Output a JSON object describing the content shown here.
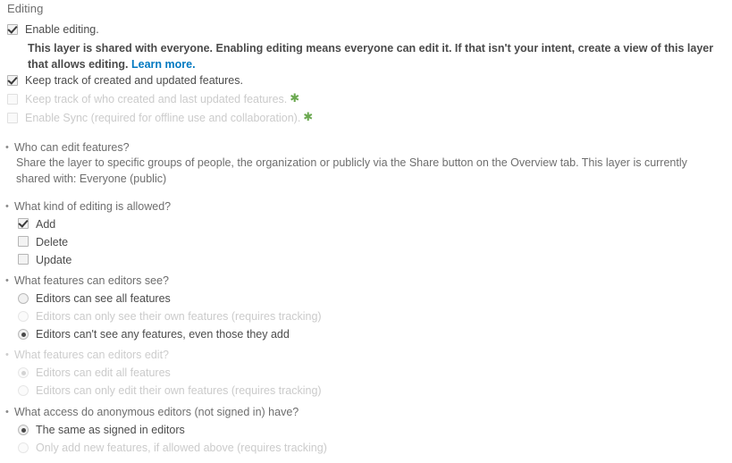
{
  "section": {
    "title": "Editing"
  },
  "checkboxes": [
    {
      "label": "Enable editing.",
      "checked": true,
      "disabled": false,
      "asterisk": false
    },
    {
      "label": "Keep track of created and updated features.",
      "checked": true,
      "disabled": false,
      "asterisk": false
    },
    {
      "label": "Keep track of who created and last updated features.",
      "checked": false,
      "disabled": true,
      "asterisk": true
    },
    {
      "label": "Enable Sync (required for offline use and collaboration).",
      "checked": false,
      "disabled": true,
      "asterisk": true
    }
  ],
  "note": {
    "text_before_link": "This layer is shared with everyone. Enabling editing means everyone can edit it. If that isn't your intent, create a view of this layer that allows editing. ",
    "link_label": "Learn more."
  },
  "questions": [
    {
      "id": "who-can-edit-features",
      "label": "Who can edit features?",
      "muted": false,
      "description": "Share the layer to specific groups of people, the organization or publicly via the Share button on the Overview tab. This layer is currently shared with: Everyone (public)",
      "options": []
    },
    {
      "id": "what-kind-of-editing-is-allowed",
      "label": "What kind of editing is allowed?",
      "muted": false,
      "description": "",
      "options": [
        {
          "type": "checkbox",
          "label": "Add",
          "checked": true,
          "disabled": false
        },
        {
          "type": "checkbox",
          "label": "Delete",
          "checked": false,
          "disabled": false
        },
        {
          "type": "checkbox",
          "label": "Update",
          "checked": false,
          "disabled": false
        }
      ]
    },
    {
      "id": "what-features-can-editors-see",
      "label": "What features can editors see?",
      "muted": false,
      "description": "",
      "options": [
        {
          "type": "radio",
          "label": "Editors can see all features",
          "checked": false,
          "disabled": false
        },
        {
          "type": "radio",
          "label": "Editors can only see their own features (requires tracking)",
          "checked": false,
          "disabled": true
        },
        {
          "type": "radio",
          "label": "Editors can't see any features, even those they add",
          "checked": true,
          "disabled": false
        }
      ]
    },
    {
      "id": "what-features-can-editors-edit",
      "label": "What features can editors edit?",
      "muted": true,
      "description": "",
      "options": [
        {
          "type": "radio",
          "label": "Editors can edit all features",
          "checked": true,
          "disabled": true
        },
        {
          "type": "radio",
          "label": "Editors can only edit their own features (requires tracking)",
          "checked": false,
          "disabled": true
        }
      ]
    },
    {
      "id": "what-access-do-anonymous-editors-have",
      "label": "What access do anonymous editors (not signed in) have?",
      "muted": false,
      "description": "",
      "options": [
        {
          "type": "radio",
          "label": "The same as signed in editors",
          "checked": true,
          "disabled": false
        },
        {
          "type": "radio",
          "label": "Only add new features, if allowed above (requires tracking)",
          "checked": false,
          "disabled": true
        }
      ]
    }
  ],
  "colors": {
    "link": "#0079c1",
    "asterisk": "#6aa84f",
    "text": "#4c4c4c",
    "muted_text": "#cbcbcb",
    "label_text": "#6e6e6e"
  }
}
